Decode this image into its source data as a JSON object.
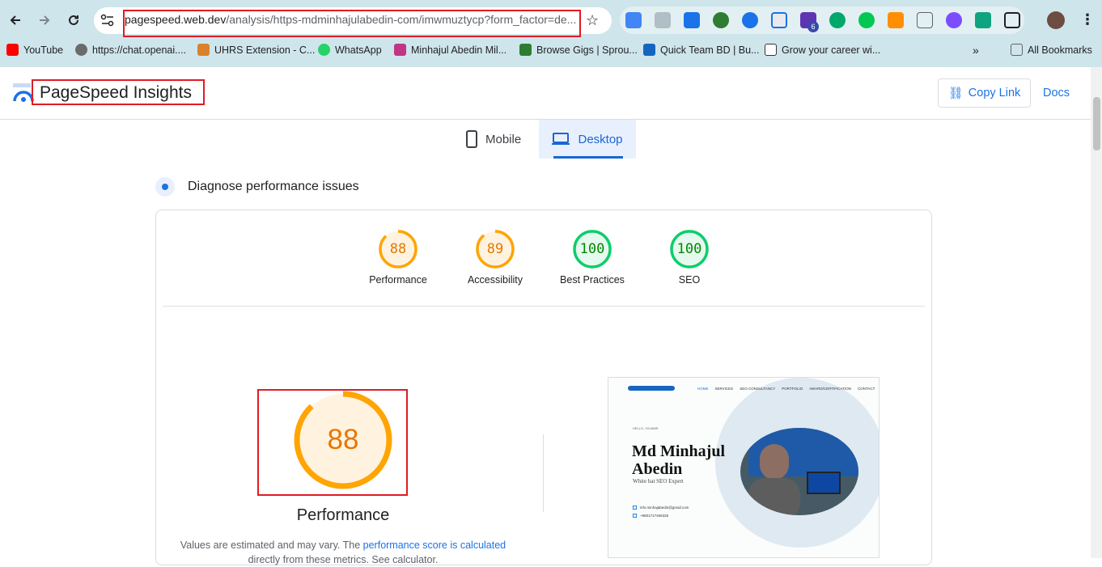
{
  "browser": {
    "url_host": "pagespeed.web.dev",
    "url_path": "/analysis/https-mdminhajulabedin-com/imwmuztycp?form_factor=de...",
    "ext_badge": "6",
    "bookmarks": [
      {
        "label": "YouTube",
        "icon": "youtube-icon",
        "color": "#ff0000"
      },
      {
        "label": "https://chat.openai....",
        "icon": "openai-icon",
        "color": "#6b6b6b"
      },
      {
        "label": "UHRS Extension - C...",
        "icon": "uhrs-icon",
        "color": "#d9822b"
      },
      {
        "label": "WhatsApp",
        "icon": "whatsapp-icon",
        "color": "#25d366"
      },
      {
        "label": "Minhajul Abedin Mil...",
        "icon": "instagram-icon",
        "color": "#c13584"
      },
      {
        "label": "Browse Gigs | Sprou...",
        "icon": "sprout-icon",
        "color": "#2e7d32"
      },
      {
        "label": "Quick Team BD | Bu...",
        "icon": "quickteam-icon",
        "color": "#1565c0"
      },
      {
        "label": "Grow your career wi...",
        "icon": "career-icon",
        "color": "#333333"
      }
    ],
    "all_bookmarks": "All Bookmarks"
  },
  "header": {
    "title": "PageSpeed Insights",
    "copy_link": "Copy Link",
    "docs": "Docs"
  },
  "tabs": {
    "mobile": "Mobile",
    "desktop": "Desktop"
  },
  "section_title": "Diagnose performance issues",
  "scores": [
    {
      "label": "Performance",
      "value": "88",
      "color": "#e67700",
      "track": "#ffa400",
      "fraction": 0.88
    },
    {
      "label": "Accessibility",
      "value": "89",
      "color": "#e67700",
      "track": "#ffa400",
      "fraction": 0.89
    },
    {
      "label": "Best Practices",
      "value": "100",
      "color": "#008800",
      "track": "#0cce6b",
      "fraction": 1.0
    },
    {
      "label": "SEO",
      "value": "100",
      "color": "#008800",
      "track": "#0cce6b",
      "fraction": 1.0
    }
  ],
  "main_score": {
    "value": "88",
    "label": "Performance",
    "fraction": 0.88
  },
  "note": {
    "prefix": "Values are estimated and may vary. The ",
    "link": "performance score is calculated",
    "suffix_partial": "directly from these metrics. See calculator."
  },
  "preview": {
    "nav": [
      "HOME",
      "SERVICES",
      "SEO CONSULTANCY",
      "PORTFOLIO",
      "AWARD/CERTIFICATION",
      "CONTACT"
    ],
    "hello": "HELLO, I'M AMIR",
    "name_line1": "Md Minhajul",
    "name_line2": "Abedin",
    "tagline": "White hat SEO Expert",
    "email": "info.minhajabedin@gmail.com",
    "phone": "+8801717465326"
  }
}
